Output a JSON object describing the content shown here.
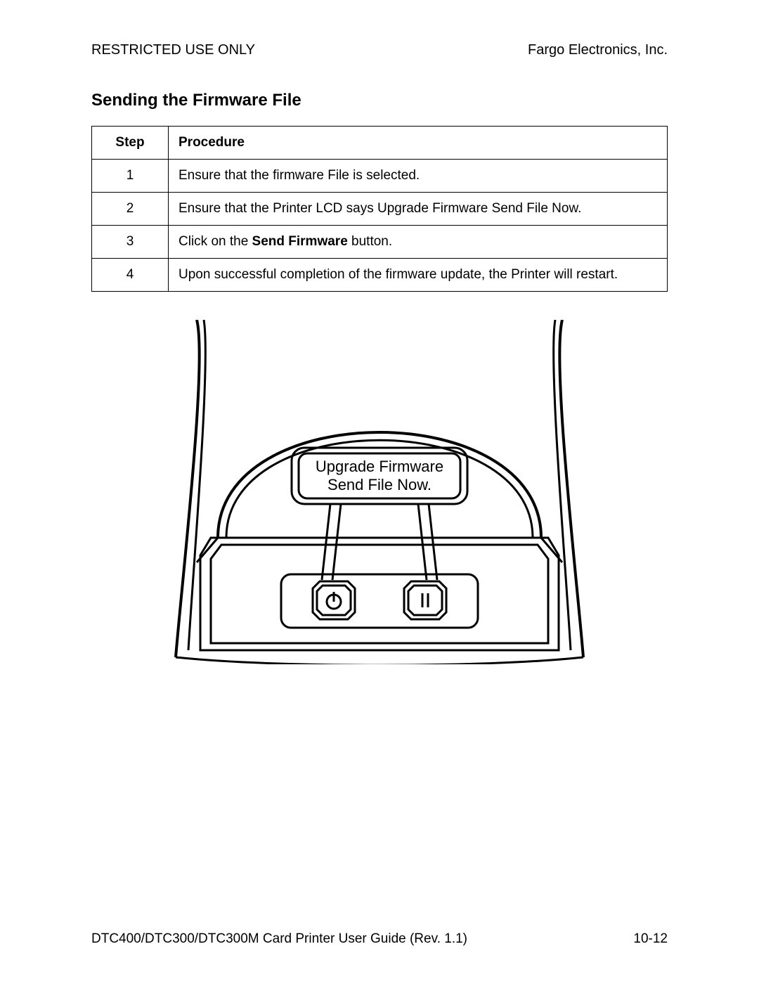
{
  "header": {
    "left": "RESTRICTED USE ONLY",
    "right": "Fargo Electronics, Inc."
  },
  "section_title": "Sending the Firmware File",
  "table": {
    "head": {
      "step": "Step",
      "procedure": "Procedure"
    },
    "rows": [
      {
        "step": "1",
        "proc": "Ensure that the firmware File is selected."
      },
      {
        "step": "2",
        "proc": "Ensure that the Printer LCD says Upgrade Firmware Send File Now."
      },
      {
        "step": "3",
        "proc_pre": "Click on the ",
        "proc_bold": "Send Firmware",
        "proc_post": " button."
      },
      {
        "step": "4",
        "proc": "Upon successful completion of the firmware update, the Printer will restart."
      }
    ]
  },
  "figure": {
    "lcd_line1": "Upgrade Firmware",
    "lcd_line2": "Send File Now."
  },
  "footer": {
    "left": "DTC400/DTC300/DTC300M Card Printer User Guide (Rev. 1.1)",
    "right": "10-12"
  }
}
